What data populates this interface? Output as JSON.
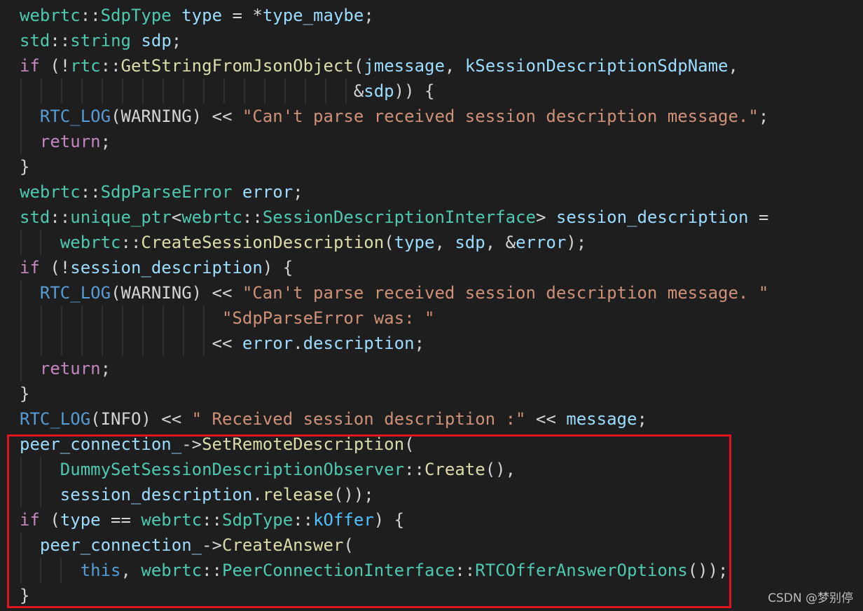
{
  "colors": {
    "namespace": "#4ec9b0",
    "keyword": "#c586c0",
    "function": "#dcdcaa",
    "variable": "#9cdcfe",
    "string": "#ce9178",
    "constant": "#4fc1ff",
    "text": "#d4d4d4",
    "macro": "#569cd6",
    "highlight": "#e0141d"
  },
  "editor": {
    "lines": [
      [
        [
          "webrtc",
          "ns"
        ],
        [
          "::",
          "p"
        ],
        [
          "SdpType",
          "ns"
        ],
        [
          " ",
          "p"
        ],
        [
          "type",
          "v"
        ],
        [
          " = *",
          "p"
        ],
        [
          "type_maybe",
          "v"
        ],
        [
          ";",
          "p"
        ]
      ],
      [
        [
          "std",
          "ns"
        ],
        [
          "::",
          "p"
        ],
        [
          "string",
          "ns"
        ],
        [
          " ",
          "p"
        ],
        [
          "sdp",
          "v"
        ],
        [
          ";",
          "p"
        ]
      ],
      [
        [
          "if",
          "k"
        ],
        [
          " (!",
          "p"
        ],
        [
          "rtc",
          "ns"
        ],
        [
          "::",
          "p"
        ],
        [
          "GetStringFromJsonObject",
          "f"
        ],
        [
          "(",
          "p"
        ],
        [
          "jmessage",
          "v"
        ],
        [
          ", ",
          "p"
        ],
        [
          "kSessionDescriptionSdpName",
          "v"
        ],
        [
          ",",
          "p"
        ]
      ],
      [
        [
          "                                 ",
          "p"
        ],
        [
          "&",
          "p"
        ],
        [
          "sdp",
          "v"
        ],
        [
          ")) {",
          "p"
        ]
      ],
      [
        [
          "  ",
          "p"
        ],
        [
          "RTC_LOG",
          "m"
        ],
        [
          "(WARNING) << ",
          "p"
        ],
        [
          "\"Can't parse received session description message.\"",
          "s"
        ],
        [
          ";",
          "p"
        ]
      ],
      [
        [
          "  ",
          "p"
        ],
        [
          "return",
          "k"
        ],
        [
          ";",
          "p"
        ]
      ],
      [
        [
          "}",
          "p"
        ]
      ],
      [
        [
          "webrtc",
          "ns"
        ],
        [
          "::",
          "p"
        ],
        [
          "SdpParseError",
          "ns"
        ],
        [
          " ",
          "p"
        ],
        [
          "error",
          "v"
        ],
        [
          ";",
          "p"
        ]
      ],
      [
        [
          "std",
          "ns"
        ],
        [
          "::",
          "p"
        ],
        [
          "unique_ptr",
          "ns"
        ],
        [
          "<",
          "p"
        ],
        [
          "webrtc",
          "ns"
        ],
        [
          "::",
          "p"
        ],
        [
          "SessionDescriptionInterface",
          "ns"
        ],
        [
          "> ",
          "p"
        ],
        [
          "session_description",
          "v"
        ],
        [
          " =",
          "p"
        ]
      ],
      [
        [
          "    ",
          "p"
        ],
        [
          "webrtc",
          "ns"
        ],
        [
          "::",
          "p"
        ],
        [
          "CreateSessionDescription",
          "f"
        ],
        [
          "(",
          "p"
        ],
        [
          "type",
          "v"
        ],
        [
          ", ",
          "p"
        ],
        [
          "sdp",
          "v"
        ],
        [
          ", &",
          "p"
        ],
        [
          "error",
          "v"
        ],
        [
          ");",
          "p"
        ]
      ],
      [
        [
          "if",
          "k"
        ],
        [
          " (!",
          "p"
        ],
        [
          "session_description",
          "v"
        ],
        [
          ") {",
          "p"
        ]
      ],
      [
        [
          "  ",
          "p"
        ],
        [
          "RTC_LOG",
          "m"
        ],
        [
          "(WARNING) << ",
          "p"
        ],
        [
          "\"Can't parse received session description message. \"",
          "s"
        ]
      ],
      [
        [
          "                    ",
          "p"
        ],
        [
          "\"SdpParseError was: \"",
          "s"
        ]
      ],
      [
        [
          "                   ",
          "p"
        ],
        [
          "<< ",
          "p"
        ],
        [
          "error",
          "v"
        ],
        [
          ".",
          "p"
        ],
        [
          "description",
          "v"
        ],
        [
          ";",
          "p"
        ]
      ],
      [
        [
          "  ",
          "p"
        ],
        [
          "return",
          "k"
        ],
        [
          ";",
          "p"
        ]
      ],
      [
        [
          "}",
          "p"
        ]
      ],
      [
        [
          "RTC_LOG",
          "m"
        ],
        [
          "(INFO) << ",
          "p"
        ],
        [
          "\" Received session description :\"",
          "s"
        ],
        [
          " << ",
          "p"
        ],
        [
          "message",
          "v"
        ],
        [
          ";",
          "p"
        ]
      ],
      [
        [
          "peer_connection_",
          "v"
        ],
        [
          "->",
          "p"
        ],
        [
          "SetRemoteDescription",
          "f"
        ],
        [
          "(",
          "p"
        ]
      ],
      [
        [
          "    ",
          "p"
        ],
        [
          "DummySetSessionDescriptionObserver",
          "ns"
        ],
        [
          "::",
          "p"
        ],
        [
          "Create",
          "f"
        ],
        [
          "(),",
          "p"
        ]
      ],
      [
        [
          "    ",
          "p"
        ],
        [
          "session_description",
          "v"
        ],
        [
          ".",
          "p"
        ],
        [
          "release",
          "f"
        ],
        [
          "());",
          "p"
        ]
      ],
      [
        [
          "if",
          "k"
        ],
        [
          " (",
          "p"
        ],
        [
          "type",
          "v"
        ],
        [
          " == ",
          "p"
        ],
        [
          "webrtc",
          "ns"
        ],
        [
          "::",
          "p"
        ],
        [
          "SdpType",
          "ns"
        ],
        [
          "::",
          "p"
        ],
        [
          "kOffer",
          "c"
        ],
        [
          ") {",
          "p"
        ]
      ],
      [
        [
          "  ",
          "p"
        ],
        [
          "peer_connection_",
          "v"
        ],
        [
          "->",
          "p"
        ],
        [
          "CreateAnswer",
          "f"
        ],
        [
          "(",
          "p"
        ]
      ],
      [
        [
          "      ",
          "p"
        ],
        [
          "this",
          "m"
        ],
        [
          ", ",
          "p"
        ],
        [
          "webrtc",
          "ns"
        ],
        [
          "::",
          "p"
        ],
        [
          "PeerConnectionInterface",
          "ns"
        ],
        [
          "::",
          "p"
        ],
        [
          "RTCOfferAnswerOptions",
          "ns"
        ],
        [
          "());",
          "p"
        ]
      ],
      [
        [
          "}",
          "p"
        ]
      ]
    ]
  },
  "watermark": "CSDN @梦别停"
}
